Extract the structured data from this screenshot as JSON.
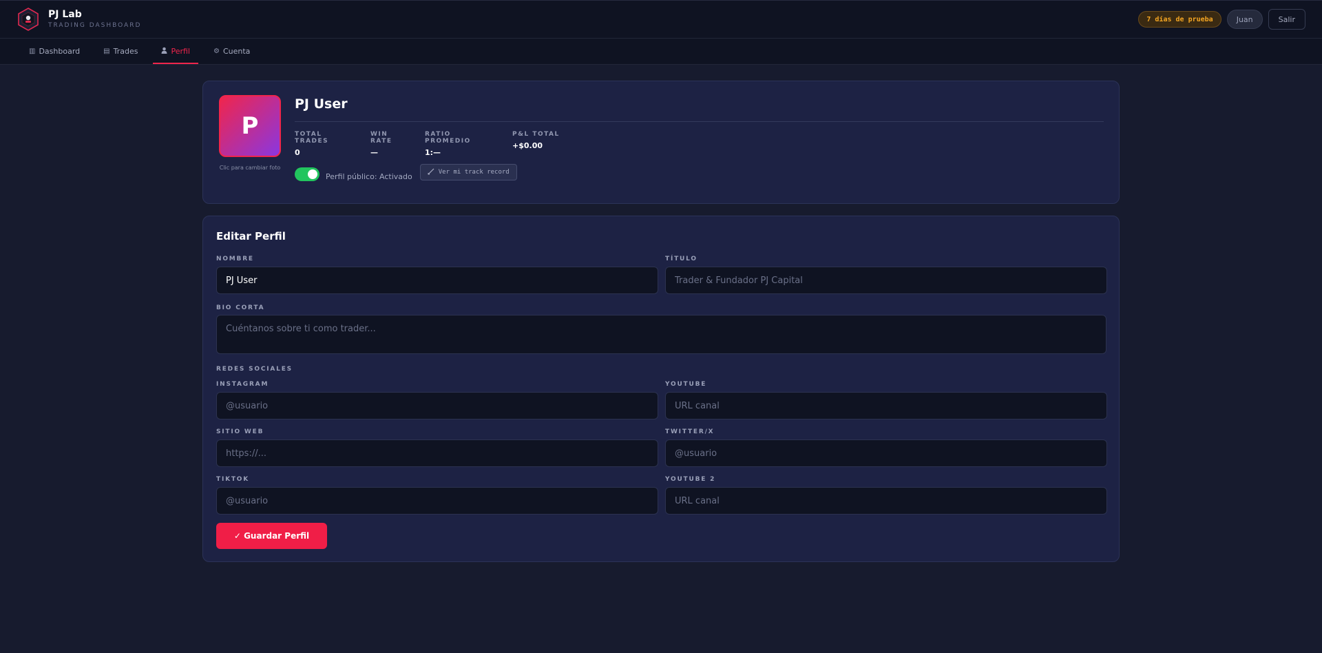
{
  "header": {
    "app_title": "PJ Lab",
    "app_subtitle": "TRADING DASHBOARD",
    "trial_badge": "7 días de prueba",
    "user_label": "Juan",
    "logout_label": "Salir"
  },
  "nav": {
    "tabs": [
      {
        "label": "Dashboard",
        "icon": "chart-icon"
      },
      {
        "label": "Trades",
        "icon": "clipboard-icon"
      },
      {
        "label": "Perfil",
        "icon": "user-icon",
        "active": true
      },
      {
        "label": "Cuenta",
        "icon": "gear-icon"
      }
    ]
  },
  "profile": {
    "avatar_initial": "P",
    "avatar_hint": "Clic para cambiar foto",
    "name": "PJ User",
    "stats": [
      {
        "label": "TOTAL TRADES",
        "value": "0"
      },
      {
        "label": "WIN RATE",
        "value": "—"
      },
      {
        "label": "RATIO PROMEDIO",
        "value": "1:—"
      },
      {
        "label": "P&L TOTAL",
        "value": "+$0.00"
      }
    ],
    "public_toggle_on": true,
    "public_label": "Perfil público: Activado",
    "track_record_label": "Ver mi track record"
  },
  "edit": {
    "title": "Editar Perfil",
    "nombre": {
      "label": "NOMBRE",
      "value": "PJ User"
    },
    "titulo": {
      "label": "TÍTULO",
      "placeholder": "Trader & Fundador PJ Capital"
    },
    "bio": {
      "label": "BIO CORTA",
      "placeholder": "Cuéntanos sobre ti como trader..."
    },
    "social_heading": "REDES SOCIALES",
    "instagram": {
      "label": "INSTAGRAM",
      "placeholder": "@usuario"
    },
    "youtube": {
      "label": "YOUTUBE",
      "placeholder": "URL canal"
    },
    "website": {
      "label": "SITIO WEB",
      "placeholder": "https://..."
    },
    "twitter": {
      "label": "TWITTER/X",
      "placeholder": "@usuario"
    },
    "tiktok": {
      "label": "TIKTOK",
      "placeholder": "@usuario"
    },
    "youtube2": {
      "label": "YOUTUBE 2",
      "placeholder": "URL canal"
    },
    "save_label": "✓ Guardar Perfil"
  },
  "colors": {
    "accent": "#f0254c",
    "toggle_on": "#22c55e",
    "trial": "#f5a623",
    "background": "#171b2e",
    "card": "#1d2244"
  }
}
